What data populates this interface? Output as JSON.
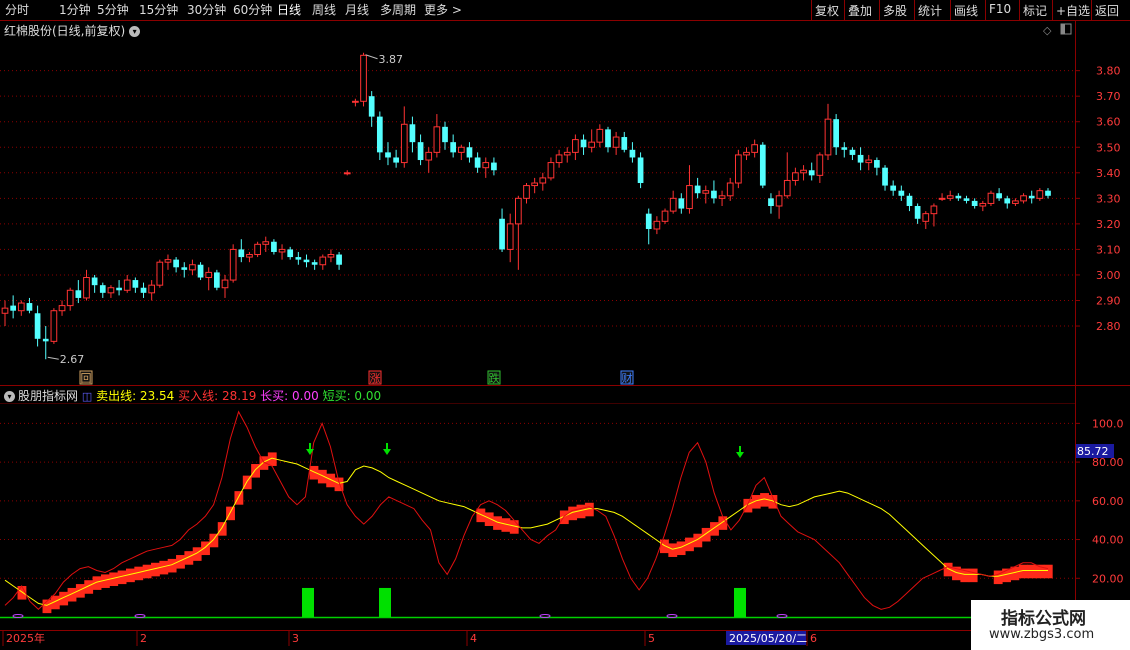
{
  "toolbar": {
    "periods": [
      "分时",
      "1分钟",
      "5分钟",
      "15分钟",
      "30分钟",
      "60分钟",
      "日线",
      "周线",
      "月线",
      "多周期",
      "更多 >"
    ],
    "active_period": "日线",
    "actions": [
      "复权",
      "叠加",
      "多股",
      "统计",
      "画线",
      "F10",
      "标记",
      "+自选",
      "返回"
    ]
  },
  "main_chart": {
    "title": "红棉股份(日线,前复权)",
    "y_ticks": [
      "3.80",
      "3.70",
      "3.60",
      "3.50",
      "3.40",
      "3.30",
      "3.20",
      "3.10",
      "3.00",
      "2.90",
      "2.80"
    ],
    "high_label": "3.87",
    "low_label": "2.67",
    "markers": [
      {
        "label": "回",
        "color": "#d0a060"
      },
      {
        "label": "涨",
        "color": "#ff3030"
      },
      {
        "label": "跌",
        "color": "#30c030"
      },
      {
        "label": "财",
        "color": "#4080ff"
      }
    ],
    "up_color": "#ff3333",
    "down_color": "#54ffff"
  },
  "indicator": {
    "name": "股朋指标网",
    "sell_label": "卖出线: 23.54",
    "buy_label": "买入线: 28.19",
    "long_label": "长买: 0.00",
    "short_label": "短买: 0.00",
    "y_ticks": [
      "100.0",
      "80.00",
      "60.00",
      "40.00",
      "20.00"
    ],
    "current_value": "85.72"
  },
  "x_axis": {
    "labels": [
      "2025年",
      "2",
      "3",
      "4",
      "5",
      "6"
    ],
    "cursor_date": "2025/05/20/二"
  },
  "watermark": {
    "line1": "指标公式网",
    "line2": "www.zbgs3.com"
  },
  "chart_data": {
    "type": "candlestick",
    "ylim": [
      2.62,
      3.92
    ],
    "candles": [
      [
        2.85,
        2.9,
        2.8,
        2.87
      ],
      [
        2.88,
        2.92,
        2.83,
        2.86
      ],
      [
        2.86,
        2.9,
        2.84,
        2.89
      ],
      [
        2.89,
        2.91,
        2.85,
        2.86
      ],
      [
        2.85,
        2.88,
        2.72,
        2.75
      ],
      [
        2.75,
        2.8,
        2.67,
        2.74
      ],
      [
        2.74,
        2.87,
        2.73,
        2.86
      ],
      [
        2.86,
        2.9,
        2.84,
        2.88
      ],
      [
        2.88,
        2.95,
        2.86,
        2.94
      ],
      [
        2.94,
        2.98,
        2.89,
        2.91
      ],
      [
        2.91,
        3.02,
        2.9,
        2.99
      ],
      [
        2.99,
        3.0,
        2.93,
        2.96
      ],
      [
        2.96,
        2.97,
        2.91,
        2.93
      ],
      [
        2.93,
        2.96,
        2.91,
        2.95
      ],
      [
        2.95,
        2.98,
        2.92,
        2.94
      ],
      [
        2.94,
        3.0,
        2.93,
        2.98
      ],
      [
        2.98,
        2.99,
        2.93,
        2.95
      ],
      [
        2.95,
        2.97,
        2.91,
        2.93
      ],
      [
        2.93,
        2.98,
        2.9,
        2.96
      ],
      [
        2.96,
        3.06,
        2.95,
        3.05
      ],
      [
        3.05,
        3.08,
        3.02,
        3.06
      ],
      [
        3.06,
        3.07,
        3.01,
        3.03
      ],
      [
        3.03,
        3.05,
        2.99,
        3.02
      ],
      [
        3.02,
        3.06,
        3.0,
        3.04
      ],
      [
        3.04,
        3.05,
        2.98,
        2.99
      ],
      [
        2.99,
        3.03,
        2.94,
        3.01
      ],
      [
        3.01,
        3.02,
        2.94,
        2.95
      ],
      [
        2.95,
        3.0,
        2.91,
        2.98
      ],
      [
        2.98,
        3.12,
        2.97,
        3.1
      ],
      [
        3.1,
        3.14,
        3.05,
        3.07
      ],
      [
        3.07,
        3.09,
        3.05,
        3.08
      ],
      [
        3.08,
        3.13,
        3.07,
        3.12
      ],
      [
        3.12,
        3.15,
        3.09,
        3.13
      ],
      [
        3.13,
        3.14,
        3.08,
        3.09
      ],
      [
        3.09,
        3.12,
        3.06,
        3.1
      ],
      [
        3.1,
        3.11,
        3.06,
        3.07
      ],
      [
        3.07,
        3.09,
        3.04,
        3.06
      ],
      [
        3.06,
        3.08,
        3.03,
        3.05
      ],
      [
        3.05,
        3.06,
        3.02,
        3.04
      ],
      [
        3.04,
        3.08,
        3.02,
        3.07
      ],
      [
        3.07,
        3.1,
        3.05,
        3.08
      ],
      [
        3.08,
        3.09,
        3.02,
        3.04
      ],
      [
        3.4,
        3.41,
        3.39,
        3.4
      ],
      [
        3.68,
        3.69,
        3.66,
        3.68
      ],
      [
        3.68,
        3.87,
        3.66,
        3.86
      ],
      [
        3.7,
        3.72,
        3.58,
        3.62
      ],
      [
        3.62,
        3.64,
        3.45,
        3.48
      ],
      [
        3.48,
        3.52,
        3.43,
        3.46
      ],
      [
        3.46,
        3.49,
        3.42,
        3.44
      ],
      [
        3.44,
        3.66,
        3.42,
        3.59
      ],
      [
        3.59,
        3.62,
        3.48,
        3.52
      ],
      [
        3.52,
        3.55,
        3.43,
        3.45
      ],
      [
        3.45,
        3.5,
        3.4,
        3.48
      ],
      [
        3.48,
        3.63,
        3.46,
        3.58
      ],
      [
        3.58,
        3.6,
        3.49,
        3.52
      ],
      [
        3.52,
        3.55,
        3.46,
        3.48
      ],
      [
        3.48,
        3.51,
        3.45,
        3.5
      ],
      [
        3.5,
        3.52,
        3.44,
        3.46
      ],
      [
        3.46,
        3.48,
        3.4,
        3.42
      ],
      [
        3.42,
        3.46,
        3.38,
        3.44
      ],
      [
        3.44,
        3.46,
        3.39,
        3.41
      ],
      [
        3.22,
        3.26,
        3.09,
        3.1
      ],
      [
        3.1,
        3.24,
        3.05,
        3.2
      ],
      [
        3.2,
        3.31,
        3.02,
        3.3
      ],
      [
        3.3,
        3.36,
        3.28,
        3.35
      ],
      [
        3.35,
        3.38,
        3.32,
        3.36
      ],
      [
        3.36,
        3.4,
        3.33,
        3.38
      ],
      [
        3.38,
        3.46,
        3.37,
        3.44
      ],
      [
        3.44,
        3.49,
        3.42,
        3.47
      ],
      [
        3.47,
        3.5,
        3.44,
        3.48
      ],
      [
        3.48,
        3.55,
        3.45,
        3.53
      ],
      [
        3.53,
        3.55,
        3.47,
        3.5
      ],
      [
        3.5,
        3.57,
        3.48,
        3.52
      ],
      [
        3.52,
        3.59,
        3.5,
        3.57
      ],
      [
        3.57,
        3.58,
        3.48,
        3.5
      ],
      [
        3.5,
        3.56,
        3.47,
        3.54
      ],
      [
        3.54,
        3.56,
        3.48,
        3.49
      ],
      [
        3.49,
        3.52,
        3.44,
        3.46
      ],
      [
        3.46,
        3.48,
        3.34,
        3.36
      ],
      [
        3.24,
        3.26,
        3.12,
        3.18
      ],
      [
        3.18,
        3.23,
        3.16,
        3.21
      ],
      [
        3.21,
        3.26,
        3.2,
        3.25
      ],
      [
        3.25,
        3.33,
        3.24,
        3.3
      ],
      [
        3.3,
        3.32,
        3.24,
        3.26
      ],
      [
        3.26,
        3.43,
        3.24,
        3.35
      ],
      [
        3.35,
        3.38,
        3.3,
        3.32
      ],
      [
        3.32,
        3.35,
        3.28,
        3.33
      ],
      [
        3.33,
        3.37,
        3.28,
        3.3
      ],
      [
        3.3,
        3.33,
        3.27,
        3.31
      ],
      [
        3.31,
        3.38,
        3.29,
        3.36
      ],
      [
        3.36,
        3.49,
        3.34,
        3.47
      ],
      [
        3.47,
        3.5,
        3.45,
        3.48
      ],
      [
        3.48,
        3.53,
        3.46,
        3.51
      ],
      [
        3.51,
        3.52,
        3.34,
        3.35
      ],
      [
        3.3,
        3.32,
        3.24,
        3.27
      ],
      [
        3.27,
        3.33,
        3.22,
        3.31
      ],
      [
        3.31,
        3.48,
        3.3,
        3.37
      ],
      [
        3.37,
        3.42,
        3.35,
        3.4
      ],
      [
        3.4,
        3.43,
        3.37,
        3.41
      ],
      [
        3.41,
        3.44,
        3.37,
        3.39
      ],
      [
        3.39,
        3.48,
        3.36,
        3.47
      ],
      [
        3.47,
        3.67,
        3.45,
        3.61
      ],
      [
        3.61,
        3.63,
        3.47,
        3.5
      ],
      [
        3.5,
        3.52,
        3.46,
        3.49
      ],
      [
        3.49,
        3.5,
        3.45,
        3.47
      ],
      [
        3.47,
        3.5,
        3.41,
        3.44
      ],
      [
        3.44,
        3.47,
        3.41,
        3.45
      ],
      [
        3.45,
        3.46,
        3.39,
        3.42
      ],
      [
        3.42,
        3.43,
        3.33,
        3.35
      ],
      [
        3.35,
        3.37,
        3.31,
        3.33
      ],
      [
        3.33,
        3.35,
        3.29,
        3.31
      ],
      [
        3.31,
        3.32,
        3.25,
        3.27
      ],
      [
        3.27,
        3.28,
        3.2,
        3.22
      ],
      [
        3.21,
        3.25,
        3.18,
        3.24
      ],
      [
        3.24,
        3.28,
        3.19,
        3.27
      ],
      [
        3.3,
        3.32,
        3.29,
        3.3
      ],
      [
        3.3,
        3.33,
        3.29,
        3.31
      ],
      [
        3.31,
        3.32,
        3.29,
        3.3
      ],
      [
        3.3,
        3.31,
        3.28,
        3.29
      ],
      [
        3.29,
        3.3,
        3.26,
        3.27
      ],
      [
        3.27,
        3.29,
        3.25,
        3.28
      ],
      [
        3.28,
        3.33,
        3.27,
        3.32
      ],
      [
        3.32,
        3.34,
        3.29,
        3.3
      ],
      [
        3.3,
        3.31,
        3.26,
        3.28
      ],
      [
        3.28,
        3.3,
        3.27,
        3.29
      ],
      [
        3.29,
        3.32,
        3.28,
        3.31
      ],
      [
        3.31,
        3.33,
        3.28,
        3.3
      ],
      [
        3.3,
        3.34,
        3.29,
        3.33
      ],
      [
        3.33,
        3.34,
        3.3,
        3.31
      ]
    ],
    "indicator_lines": {
      "ylim": [
        0,
        110
      ],
      "sell_line": [
        19,
        16,
        13,
        10,
        7,
        6,
        8,
        10,
        12,
        14,
        16,
        18,
        19,
        20,
        21,
        22,
        23,
        24,
        25,
        26,
        27,
        29,
        31,
        33,
        36,
        40,
        46,
        54,
        62,
        70,
        76,
        80,
        82,
        81,
        80,
        79,
        77,
        75,
        73,
        71,
        69,
        70,
        76,
        78,
        77,
        75,
        72,
        70,
        68,
        66,
        64,
        62,
        60,
        59,
        58,
        57,
        55,
        53,
        51,
        49,
        48,
        47,
        46,
        46,
        47,
        48,
        50,
        52,
        54,
        55,
        56,
        56,
        55,
        54,
        52,
        49,
        46,
        43,
        40,
        37,
        35,
        36,
        38,
        40,
        43,
        46,
        49,
        52,
        55,
        58,
        60,
        61,
        60,
        58,
        57,
        58,
        60,
        62,
        63,
        64,
        65,
        64,
        62,
        60,
        58,
        56,
        53,
        49,
        45,
        41,
        37,
        33,
        29,
        25,
        23,
        22,
        22,
        22,
        21,
        21,
        22,
        23,
        24,
        24,
        24,
        24
      ],
      "buy_line": [
        6,
        10,
        16,
        8,
        4,
        8,
        12,
        18,
        22,
        25,
        26,
        24,
        23,
        25,
        28,
        30,
        32,
        34,
        35,
        36,
        37,
        40,
        45,
        48,
        52,
        58,
        72,
        92,
        106,
        98,
        88,
        80,
        78,
        70,
        62,
        58,
        62,
        90,
        100,
        88,
        70,
        58,
        52,
        48,
        52,
        58,
        62,
        60,
        58,
        56,
        50,
        45,
        28,
        22,
        30,
        42,
        52,
        58,
        60,
        58,
        55,
        50,
        45,
        40,
        38,
        42,
        45,
        52,
        55,
        56,
        57,
        55,
        52,
        42,
        30,
        20,
        14,
        20,
        30,
        42,
        56,
        72,
        85,
        90,
        80,
        64,
        52,
        45,
        50,
        58,
        68,
        72,
        62,
        52,
        48,
        44,
        42,
        40,
        36,
        32,
        28,
        22,
        16,
        10,
        6,
        4,
        5,
        8,
        12,
        16,
        20,
        22,
        24,
        26,
        25,
        24,
        23,
        22,
        21,
        22,
        24,
        26,
        28,
        28,
        26,
        25
      ]
    },
    "signal_bars": [
      {
        "index": 43,
        "value": 15
      },
      {
        "index": 52,
        "value": 15
      },
      {
        "index": 100,
        "value": 15
      }
    ]
  }
}
